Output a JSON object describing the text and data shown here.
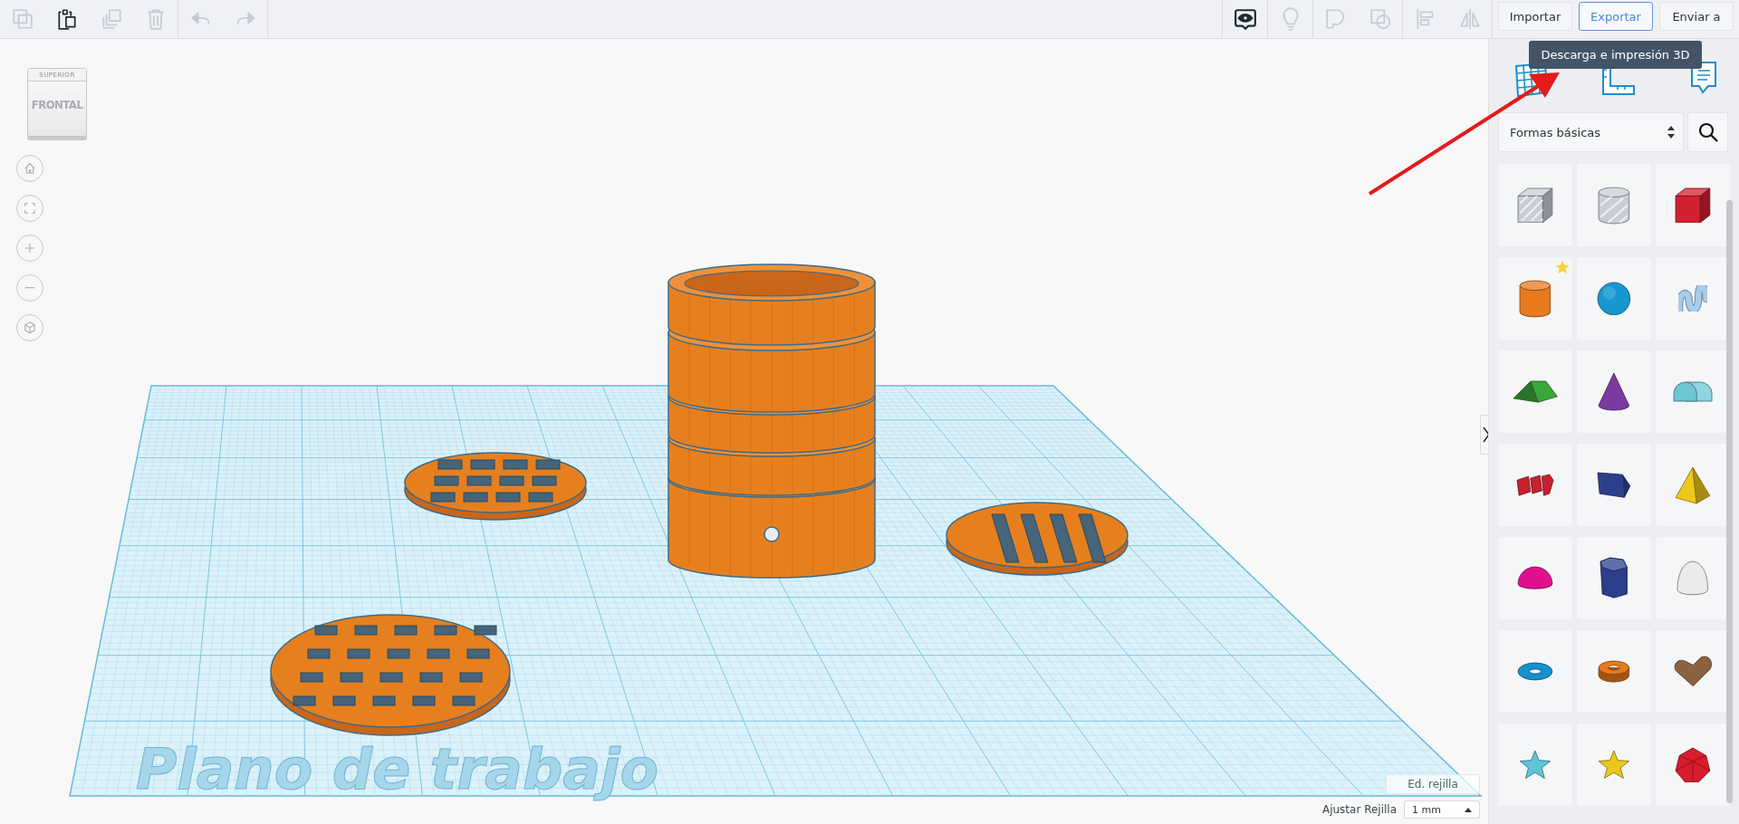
{
  "toolbar": {
    "left_groups": [
      [
        {
          "kind": "copy",
          "disabled": true
        },
        {
          "kind": "paste",
          "disabled": false
        },
        {
          "kind": "duplicate",
          "disabled": true
        },
        {
          "kind": "delete",
          "disabled": true
        }
      ],
      [
        {
          "kind": "undo",
          "disabled": true
        },
        {
          "kind": "redo",
          "disabled": true
        }
      ]
    ],
    "right_groups": [
      [
        {
          "kind": "notes",
          "disabled": false
        }
      ],
      [
        {
          "kind": "bulb",
          "disabled": true
        }
      ],
      [
        {
          "kind": "group",
          "disabled": true
        },
        {
          "kind": "ungroup",
          "disabled": true
        }
      ],
      [
        {
          "kind": "align",
          "disabled": true
        },
        {
          "kind": "mirror",
          "disabled": true
        }
      ]
    ],
    "buttons": [
      {
        "label": "Importar",
        "selected": false
      },
      {
        "label": "Exportar",
        "selected": true
      },
      {
        "label": "Enviar a",
        "selected": false
      }
    ],
    "tooltip": "Descarga e impresión 3D"
  },
  "view_cube": {
    "top_face": "SUPERIOR",
    "front_face": "FRONTAL"
  },
  "nav_buttons": [
    {
      "kind": "home"
    },
    {
      "kind": "fit"
    },
    {
      "kind": "zoomin"
    },
    {
      "kind": "zoomout"
    },
    {
      "kind": "perspective"
    }
  ],
  "workplane": {
    "label": "Plano de trabajo"
  },
  "grid_controls": {
    "edit_button": "Ed. rejilla",
    "snap_label": "Ajustar Rejilla",
    "snap_value": "1 mm"
  },
  "panel": {
    "views": [
      {
        "kind": "grid"
      },
      {
        "kind": "ruler"
      },
      {
        "kind": "notes"
      }
    ],
    "category": "Formas básicas",
    "shapes": [
      {
        "kind": "boxhole",
        "color": "#c9cdd6",
        "starred": false
      },
      {
        "kind": "cylinderhole",
        "color": "#c9cdd6",
        "starred": false
      },
      {
        "kind": "box",
        "color": "#d2202f",
        "starred": false
      },
      {
        "kind": "cylinder",
        "color": "#e67a1c",
        "starred": true
      },
      {
        "kind": "sphere",
        "color": "#1797d0",
        "starred": false
      },
      {
        "kind": "scribble",
        "color": "#a9cce8",
        "starred": false
      },
      {
        "kind": "roof",
        "color": "#3aa63a",
        "starred": false
      },
      {
        "kind": "cone",
        "color": "#7b3aa0",
        "starred": false
      },
      {
        "kind": "roundroof",
        "color": "#6cc6d4",
        "starred": false
      },
      {
        "kind": "text",
        "color": "#c8202c",
        "starred": false
      },
      {
        "kind": "prism",
        "color": "#2b3f8c",
        "starred": false
      },
      {
        "kind": "pyramid",
        "color": "#f0c81c",
        "starred": false
      },
      {
        "kind": "halfsphere",
        "color": "#e0108c",
        "starred": false
      },
      {
        "kind": "hexprism",
        "color": "#2b3f8c",
        "starred": false
      },
      {
        "kind": "paraboloid",
        "color": "#e8eaec",
        "starred": false
      },
      {
        "kind": "torus",
        "color": "#1592cc",
        "starred": false
      },
      {
        "kind": "tube",
        "color": "#e67a1c",
        "starred": false
      },
      {
        "kind": "heart",
        "color": "#8c6240",
        "starred": false
      },
      {
        "kind": "starfish",
        "color": "#5ec4d6",
        "starred": false
      },
      {
        "kind": "star",
        "color": "#e8c81c",
        "starred": false
      },
      {
        "kind": "icosahedron",
        "color": "#d81c2c",
        "starred": false
      }
    ]
  }
}
